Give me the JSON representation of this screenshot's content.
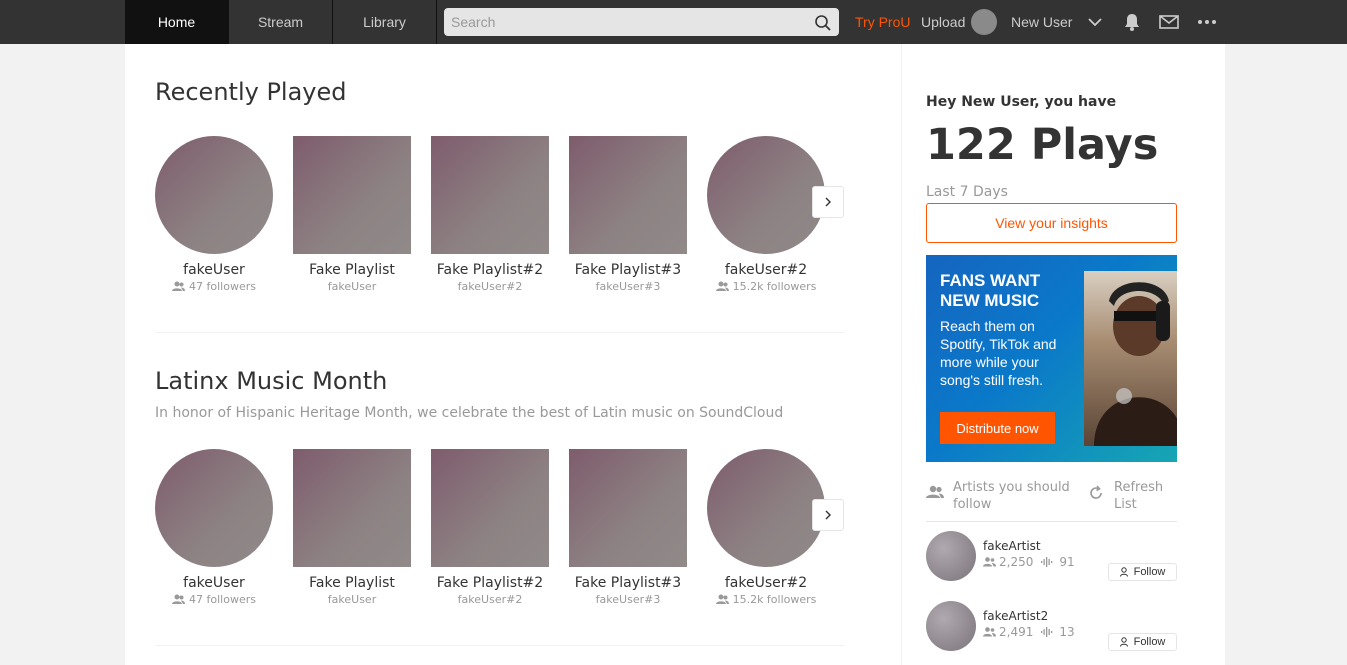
{
  "nav": {
    "tabs": [
      {
        "label": "Home",
        "active": true
      },
      {
        "label": "Stream",
        "active": false
      },
      {
        "label": "Library",
        "active": false
      }
    ],
    "search_placeholder": "Search",
    "try_pro": "Try ProU",
    "upload": "Upload",
    "username": "New User",
    "icons": [
      "search-icon",
      "chevron-down-icon",
      "bell-icon",
      "mail-icon",
      "more-icon"
    ]
  },
  "sections": [
    {
      "title": "Recently Played",
      "subtitle": "",
      "items": [
        {
          "title": "fakeUser",
          "sub": "47 followers",
          "kind": "user"
        },
        {
          "title": "Fake Playlist",
          "sub": "fakeUser",
          "kind": "playlist"
        },
        {
          "title": "Fake Playlist#2",
          "sub": "fakeUser#2",
          "kind": "playlist"
        },
        {
          "title": "Fake Playlist#3",
          "sub": "fakeUser#3",
          "kind": "playlist"
        },
        {
          "title": "fakeUser#2",
          "sub": "15.2k followers",
          "kind": "user"
        }
      ]
    },
    {
      "title": "Latinx Music Month",
      "subtitle": "In honor of Hispanic Heritage Month, we celebrate the best of Latin music on SoundCloud",
      "items": [
        {
          "title": "fakeUser",
          "sub": "47 followers",
          "kind": "user"
        },
        {
          "title": "Fake Playlist",
          "sub": "fakeUser",
          "kind": "playlist"
        },
        {
          "title": "Fake Playlist#2",
          "sub": "fakeUser#2",
          "kind": "playlist"
        },
        {
          "title": "Fake Playlist#3",
          "sub": "fakeUser#3",
          "kind": "playlist"
        },
        {
          "title": "fakeUser#2",
          "sub": "15.2k followers",
          "kind": "user"
        }
      ]
    }
  ],
  "sidebar": {
    "greeting": "Hey New User, you have",
    "plays": "122 Plays",
    "period": "Last 7 Days",
    "insights_label": "View your insights",
    "ad": {
      "headline": "FANS WANT NEW MUSIC",
      "body": "Reach them on Spotify, TikTok and more while your song's still fresh.",
      "button": "Distribute now"
    },
    "follow_header": "Artists you should follow",
    "refresh_label": "Refresh List",
    "artists": [
      {
        "name": "fakeArtist",
        "followers": "2,250",
        "tracks": "91",
        "button": "Follow"
      },
      {
        "name": "fakeArtist2",
        "followers": "2,491",
        "tracks": "13",
        "button": "Follow"
      }
    ]
  },
  "colors": {
    "accent": "#ff5500",
    "topbar": "#333333",
    "page_bg": "#f2f2f2"
  }
}
